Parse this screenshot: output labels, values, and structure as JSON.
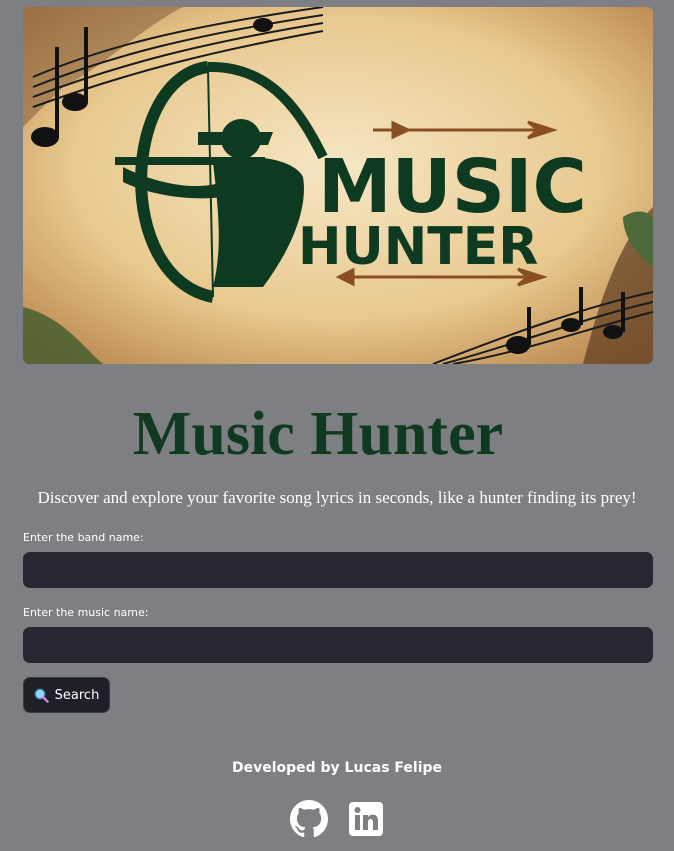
{
  "banner": {
    "logo_line1": "MUSIC",
    "logo_line2": "HUNTER"
  },
  "header": {
    "title": "Music Hunter",
    "subtitle": "Discover and explore your favorite song lyrics in seconds, like a hunter finding its prey!"
  },
  "form": {
    "band_label": "Enter the band name:",
    "band_value": "",
    "music_label": "Enter the music name:",
    "music_value": "",
    "search_label": "Search",
    "search_icon": "magnifier-icon"
  },
  "footer": {
    "credit": "Developed by Lucas Felipe",
    "links": [
      {
        "name": "github",
        "icon": "github-icon"
      },
      {
        "name": "linkedin",
        "icon": "linkedin-icon"
      }
    ]
  },
  "colors": {
    "background": "#7d7f83",
    "title": "#0f3a1f",
    "input_bg": "#262730",
    "button_bg": "#1e1f27"
  }
}
